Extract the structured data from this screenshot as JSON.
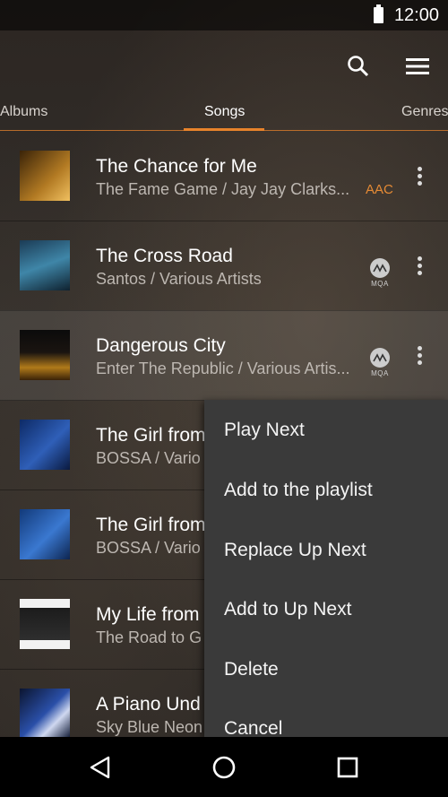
{
  "status": {
    "time": "12:00"
  },
  "tabs": {
    "albums": "Albums",
    "songs": "Songs",
    "genres": "Genres"
  },
  "songs": [
    {
      "title": "The Chance for Me",
      "subtitle": "The Fame Game / Jay Jay Clarks...",
      "badge": "AAC"
    },
    {
      "title": "The Cross Road",
      "subtitle": "Santos / Various Artists",
      "badge": "MQA"
    },
    {
      "title": "Dangerous City",
      "subtitle": "Enter The Republic / Various Artis...",
      "badge": "MQA"
    },
    {
      "title": "The Girl from",
      "subtitle": "BOSSA / Vario"
    },
    {
      "title": "The Girl from",
      "subtitle": "BOSSA / Vario"
    },
    {
      "title": "My Life from",
      "subtitle": "The Road to G"
    },
    {
      "title": "A Piano Und",
      "subtitle": "Sky Blue Neon"
    }
  ],
  "context_menu": {
    "items": [
      "Play Next",
      "Add to the playlist",
      "Replace Up Next",
      "Add to Up Next",
      "Delete",
      "Cancel"
    ]
  },
  "icons": {
    "search": "search-icon",
    "menu": "hamburger-menu-icon",
    "more": "more-vert-icon",
    "back": "back-triangle-icon",
    "home": "home-circle-icon",
    "recents": "recents-square-icon"
  },
  "colors": {
    "accent": "#e8832b",
    "aac": "#e58a35"
  }
}
